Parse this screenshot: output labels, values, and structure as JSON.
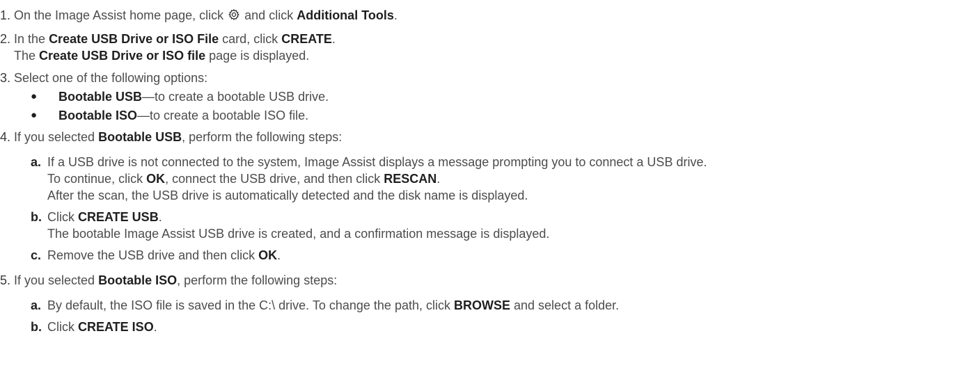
{
  "steps": [
    {
      "num": "1.",
      "parts": [
        "On the Image Assist home page, click",
        "and click",
        "Additional Tools",
        "."
      ]
    },
    {
      "num": "2.",
      "parts": [
        "In the",
        "Create USB Drive or ISO File",
        "card, click",
        "CREATE",
        "."
      ],
      "result": [
        "The",
        "Create USB Drive or ISO file",
        "page is displayed."
      ]
    },
    {
      "num": "3.",
      "text": "Select one of the following options:",
      "bullets": [
        {
          "mark": "●",
          "bold": "Bootable USB",
          "rest": "—to create a bootable USB drive."
        },
        {
          "mark": "●",
          "bold": "Bootable ISO",
          "rest": "—to create a bootable ISO file."
        }
      ]
    },
    {
      "num": "4.",
      "parts": [
        "If you selected",
        "Bootable USB",
        ", perform the following steps:"
      ],
      "substeps": [
        {
          "letter": "a.",
          "line1": "If a USB drive is not connected to the system, Image Assist displays a message prompting you to connect a USB drive.",
          "line2": [
            "To continue, click",
            "OK",
            ", connect the USB drive, and then click",
            "RESCAN",
            "."
          ],
          "line3": "After the scan, the USB drive is automatically detected and the disk name is displayed."
        },
        {
          "letter": "b.",
          "line1": [
            "Click",
            "CREATE USB",
            "."
          ],
          "line2": "The bootable Image Assist USB drive is created, and a confirmation message is displayed."
        },
        {
          "letter": "c.",
          "line1": [
            "Remove the USB drive and then click",
            "OK",
            "."
          ]
        }
      ]
    },
    {
      "num": "5.",
      "parts": [
        "If you selected",
        "Bootable ISO",
        ", perform the following steps:"
      ],
      "substeps": [
        {
          "letter": "a.",
          "line1": [
            "By default, the ISO file is saved in the C:\\ drive. To change the path, click",
            "BROWSE",
            "and select a folder."
          ]
        },
        {
          "letter": "b.",
          "line1": [
            "Click",
            "CREATE ISO",
            "."
          ]
        }
      ]
    }
  ],
  "icons": {
    "settings": "gear-icon"
  }
}
